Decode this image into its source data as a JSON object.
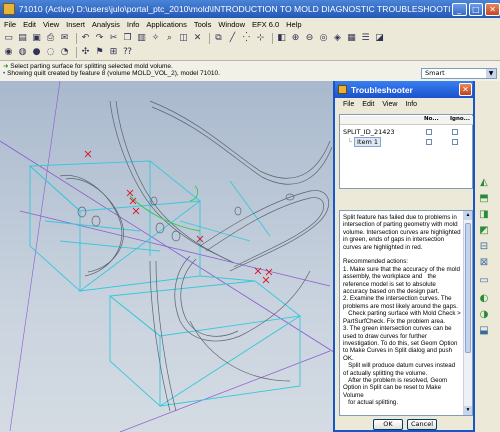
{
  "window": {
    "title": "71010 (Active) D:\\users\\julo\\portal_ptc_2010\\mold\\INTRODUCTION TO MOLD DIAGNOSTIC TROUBLESHOOTING",
    "minimize": "_",
    "maximize": "□",
    "close": "✕"
  },
  "menubar": {
    "items": [
      "File",
      "Edit",
      "View",
      "Insert",
      "Analysis",
      "Info",
      "Applications",
      "Tools",
      "Window",
      "EFX 6.0",
      "Help"
    ]
  },
  "messages": {
    "line1": "Select parting surface for splitting selected mold volume.",
    "line2": "Showing quilt created by feature 8 (volume MOLD_VOL_2), model 71010."
  },
  "selection_filter": {
    "value": "Smart"
  },
  "troubleshooter": {
    "title": "Troubleshooter",
    "menu": [
      "File",
      "Edit",
      "View",
      "Info"
    ],
    "columns": [
      "No...",
      "Igno..."
    ],
    "tree": {
      "root": "SPLIT_ID_21423",
      "child": "Item 1"
    },
    "text": "Split feature has failed due to problems in intersection of parting geometry with mold volume. Intersection curves are highlighted in green, ends of gaps in intersection curves are highlighted in red.\n\nRecommended actions:\n1. Make sure that the accuracy of the mold assembly, the workplace and   the reference model is set to absolute accuracy based on the design part.\n2. Examine the intersection curves. The problems are most likely around the gaps.\n   Check parting surface with Mold Check > PartSurfCheck. Fix the problem area.\n3. The green intersection curves can be used to draw curves for further   investigation. To do this, set Geom Option to Make Curves in Split dialog and push OK.\n   Split will produce datum curves instead of actually splitting the volume.\n   After the problem is resolved, Geom Option in Split can be reset to Make Volume\n   for actual splitting.",
    "ok": "OK",
    "cancel": "Cancel"
  },
  "colors": {
    "titlebar": "#2458b8",
    "viewport_bg": "#c8d2de",
    "geometry_cyan": "#37c8d8",
    "geometry_dark": "#5a6470",
    "datum_purple": "#8a5ad0",
    "gap_marker": "#d81a2a"
  }
}
